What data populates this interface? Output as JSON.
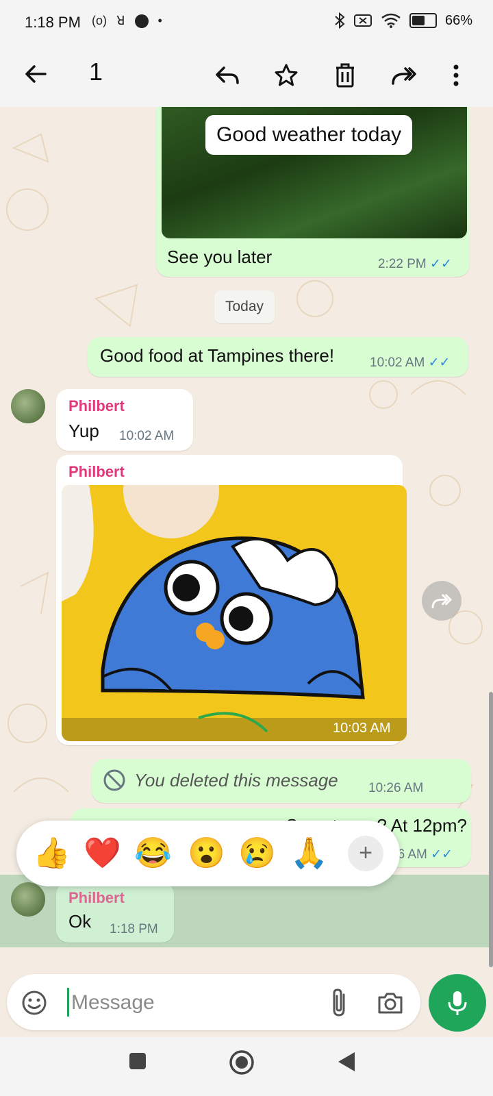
{
  "status_bar": {
    "time": "1:18 PM",
    "left_icons": [
      "(o)",
      "ꓤ"
    ],
    "battery_percent": "66%",
    "battery_level": 0.66
  },
  "header": {
    "selected_count": "1",
    "icons": [
      "back-arrow-icon",
      "reply-icon",
      "star-icon",
      "delete-icon",
      "forward-icon",
      "more-options-icon"
    ]
  },
  "messages": {
    "m1": {
      "image_caption": "Good weather today",
      "text": "See you later",
      "time": "2:22 PM",
      "ticks": "✓✓"
    },
    "date_divider": "Today",
    "m2": {
      "text": "Good food at Tampines there!",
      "time": "10:02 AM",
      "ticks": "✓✓"
    },
    "m3": {
      "sender": "Philbert",
      "text": "Yup",
      "time": "10:02 AM"
    },
    "m4": {
      "sender": "Philbert",
      "time": "10:03 AM"
    },
    "m5": {
      "text": "You deleted this message",
      "time": "10:26 AM"
    },
    "m6": {
      "text_partial": "S... ...t ... ...? At 12pm?",
      "time_partial": "36 AM",
      "ticks": "✓✓"
    },
    "m7": {
      "sender": "Philbert",
      "text": "Ok",
      "time": "1:18 PM"
    }
  },
  "reactions": [
    "👍",
    "❤️",
    "😂",
    "😮",
    "😢",
    "🙏"
  ],
  "reaction_more": "+",
  "composer": {
    "placeholder": "Message",
    "value": ""
  },
  "colors": {
    "outgoing_bubble": "#d9fdd3",
    "incoming_bubble": "#ffffff",
    "sender_name": "#e13a7a",
    "read_ticks": "#2a8ad8",
    "mic_button": "#20a65b"
  }
}
